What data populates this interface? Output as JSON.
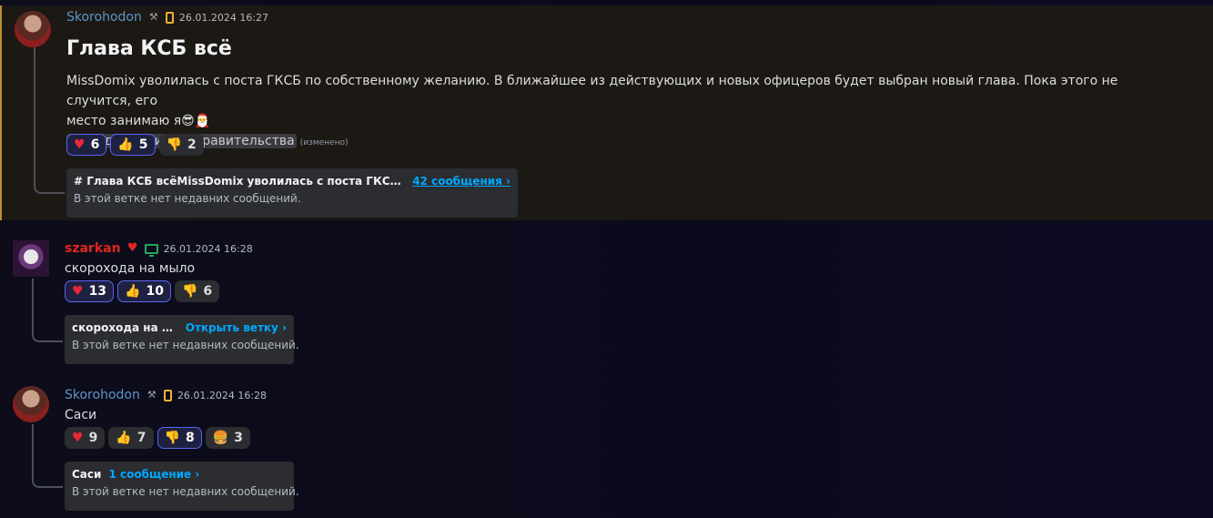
{
  "messages": [
    {
      "author": "Skorohodon",
      "timestamp": "26.01.2024 16:27",
      "title": "Глава КСБ всё",
      "text": "MissDomix уволилась с поста ГКСБ по собственному желанию. В ближайшее из действующих и новых офицеров будет выбран новый глава. Пока этого не случится, его",
      "text_line2": "место занимаю я",
      "text_emojis": "😎🎅",
      "mention": "@Уведомления от правительства",
      "edited": "(изменено)",
      "reactions": [
        {
          "emoji": "heart",
          "count": "6",
          "active": true
        },
        {
          "emoji": "thumbs-up",
          "count": "5",
          "active": true
        },
        {
          "emoji": "thumbs-down",
          "count": "2",
          "active": false
        }
      ],
      "thread": {
        "name": "# Глава КСБ всёMissDomix уволилась с поста ГКСБ по со...",
        "link": "42 сообщения ›",
        "subtitle": "В этой ветке нет недавних сообщений."
      }
    },
    {
      "author": "szarkan",
      "timestamp": "26.01.2024 16:28",
      "text": "скорохода на мыло",
      "reactions": [
        {
          "emoji": "heart",
          "count": "13",
          "active": true
        },
        {
          "emoji": "thumbs-up",
          "count": "10",
          "active": true
        },
        {
          "emoji": "thumbs-down",
          "count": "6",
          "active": false
        }
      ],
      "thread": {
        "name": "скорохода на мыло",
        "link": "Открыть ветку ›",
        "subtitle": "В этой ветке нет недавних сообщений."
      }
    },
    {
      "author": "Skorohodon",
      "timestamp": "26.01.2024 16:28",
      "text": "Саси",
      "reactions": [
        {
          "emoji": "heart",
          "count": "9",
          "active": false
        },
        {
          "emoji": "thumbs-up",
          "count": "7",
          "active": false
        },
        {
          "emoji": "thumbs-down",
          "count": "8",
          "active": true
        },
        {
          "emoji": "burger",
          "count": "3",
          "active": false
        }
      ],
      "thread": {
        "name": "Саси",
        "link": "1 сообщение ›",
        "subtitle": "В этой ветке нет недавних сообщений."
      }
    }
  ],
  "colors": {
    "highlight_bg": "#1c1814",
    "highlight_border": "#b8922c",
    "link": "#00a8fc",
    "username_skorohodon": "#5b95c8",
    "username_szarkan": "#e0261f",
    "mobile_status": "#f0b132",
    "desktop_status": "#23a55a"
  }
}
